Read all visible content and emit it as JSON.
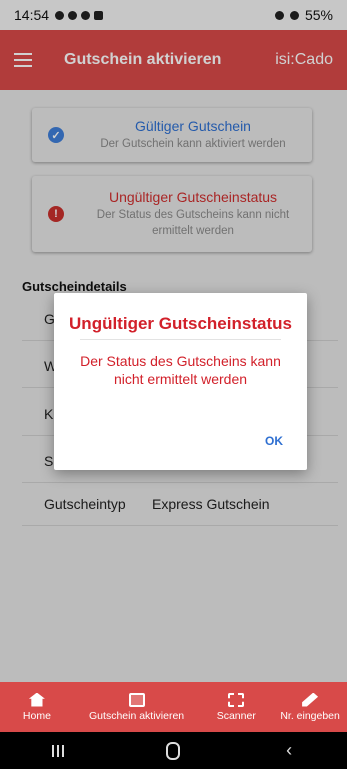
{
  "status_bar": {
    "time": "14:54",
    "battery": "55%"
  },
  "app_bar": {
    "title": "Gutschein aktivieren",
    "brand": "isi:Cado"
  },
  "cards": {
    "valid": {
      "title": "Gültiger Gutschein",
      "subtitle": "Der Gutschein kann aktiviert werden"
    },
    "invalid": {
      "title": "Ungültiger Gutscheinstatus",
      "subtitle": "Der Status des Gutscheins kann nicht ermittelt werden"
    }
  },
  "details": {
    "heading": "Gutscheindetails",
    "rows": [
      {
        "label": "G",
        "value": ""
      },
      {
        "label": "W",
        "value": ""
      },
      {
        "label": "K",
        "value": ""
      },
      {
        "label": "S",
        "value": ""
      },
      {
        "label": "Gutscheintyp",
        "value": "Express Gutschein"
      }
    ]
  },
  "dialog": {
    "title": "Ungültiger Gutscheinstatus",
    "message": "Der Status des Gutscheins kann nicht ermittelt werden",
    "ok_label": "OK"
  },
  "bottom_nav": [
    {
      "label": "Home",
      "icon": "home-icon"
    },
    {
      "label": "Gutschein aktivieren",
      "icon": "check-box-icon"
    },
    {
      "label": "Scanner",
      "icon": "scanner-icon"
    },
    {
      "label": "Nr. eingeben",
      "icon": "edit-icon"
    }
  ],
  "colors": {
    "primary": "#d84a49",
    "error": "#d2202a",
    "accent": "#2e6fd1"
  }
}
